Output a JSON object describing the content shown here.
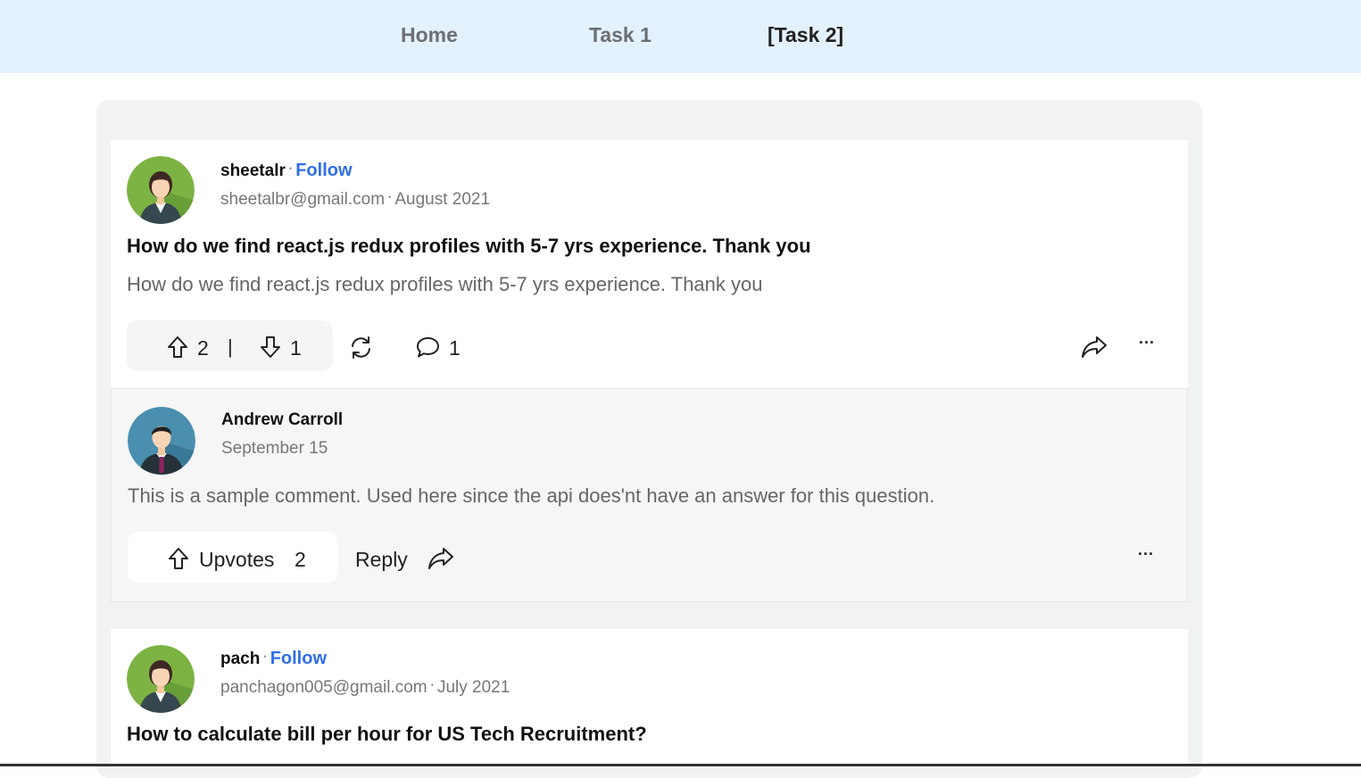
{
  "nav": {
    "items": [
      {
        "label": "Home"
      },
      {
        "label": "Task 1"
      },
      {
        "label": "[Task 2]"
      }
    ]
  },
  "posts": [
    {
      "author": "sheetalr",
      "follow_label": "Follow",
      "email": "sheetalbr@gmail.com",
      "date": "August 2021",
      "title": "How do we find react.js redux profiles with 5-7 yrs experience. Thank you",
      "body": "How do we find react.js redux profiles with 5-7 yrs experience. Thank you",
      "upvotes": "2",
      "downvotes": "1",
      "comments": "1",
      "vote_separator": "|",
      "more_label": "···"
    },
    {
      "author": "pach",
      "follow_label": "Follow",
      "email": "panchagon005@gmail.com",
      "date": "July 2021",
      "title": "How to calculate bill per hour for US Tech Recruitment?"
    }
  ],
  "comment": {
    "author": "Andrew Carroll",
    "date": "September 15",
    "text": "This is a sample comment. Used here since the api does'nt have an answer for this question.",
    "upvotes_label": "Upvotes",
    "upvotes": "2",
    "reply_label": "Reply",
    "more_label": "···"
  },
  "meta_separator": "·",
  "icons": {
    "upvote": "arrow-up-icon",
    "downvote": "arrow-down-icon",
    "repost": "refresh-icon",
    "comment": "speech-bubble-icon",
    "share": "share-arrow-icon",
    "more": "more-dots-icon"
  },
  "colors": {
    "nav_background": "#e3f1fc",
    "follow_link": "#2f6fe8",
    "feed_background": "#f1f2f2"
  }
}
